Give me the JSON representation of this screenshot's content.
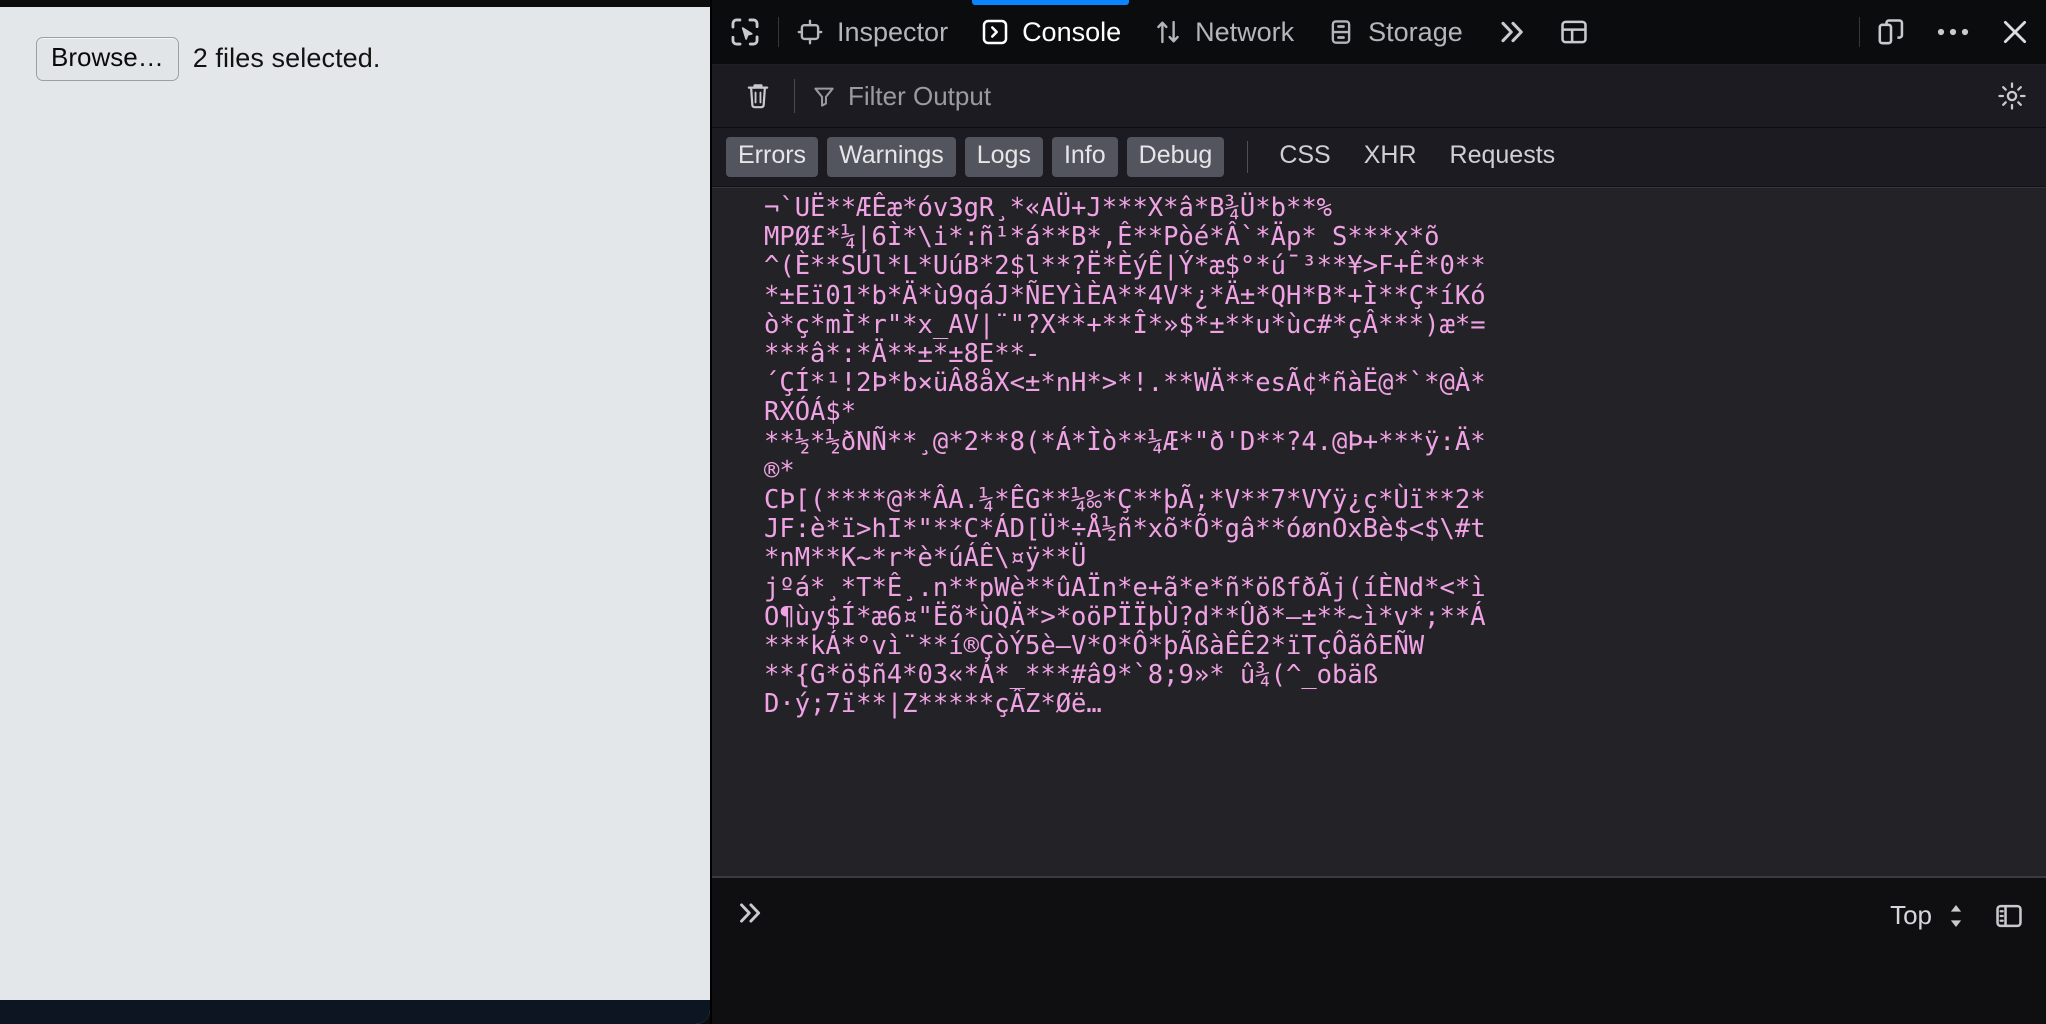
{
  "page": {
    "file_input": {
      "browse_label": "Browse…",
      "status_text": "2 files selected."
    }
  },
  "devtools": {
    "toolbar": {
      "picker_icon": "element-picker-icon",
      "tabs": [
        {
          "label": "Inspector",
          "icon": "inspector-icon",
          "active": false
        },
        {
          "label": "Console",
          "icon": "console-prompt-icon",
          "active": true
        },
        {
          "label": "Network",
          "icon": "network-arrows-icon",
          "active": false
        },
        {
          "label": "Storage",
          "icon": "storage-drawers-icon",
          "active": false
        }
      ],
      "overflow_icon": "chevron-double-right-icon",
      "layout_icon": "panel-layout-icon",
      "responsive_icon": "responsive-design-mode-icon",
      "meatball_icon": "ellipsis-icon",
      "close_icon": "close-icon"
    },
    "filterbar": {
      "clear_icon": "trash-icon",
      "filter_icon": "funnel-icon",
      "filter_placeholder": "Filter Output",
      "filter_value": "",
      "settings_icon": "gear-icon"
    },
    "filters": {
      "toggles": [
        {
          "label": "Errors",
          "on": true
        },
        {
          "label": "Warnings",
          "on": true
        },
        {
          "label": "Logs",
          "on": true
        },
        {
          "label": "Info",
          "on": true
        },
        {
          "label": "Debug",
          "on": true
        },
        {
          "label": "CSS",
          "on": false
        },
        {
          "label": "XHR",
          "on": false
        },
        {
          "label": "Requests",
          "on": false
        }
      ]
    },
    "console_output": {
      "message": "¬`UË**ÆÊæ*óv3gR¸*«AÜ+J***X*â*B¾Ü*b**%\nMPØ£*¼|6Ì*\\i*:ñ¹*á**B*,Ê**Pòé*Â`*Äp* S***x*õ\n^(È**SÚl*L*UúB*2$l**?Ë*ÈýÊ|Ý*æ$°*ú¯³**¥>F+Ê*0**\n*±Eï01*b*Ä*ù9qáJ*ÑEYìÈA**4V*¿*Ä±*QH*B*+Ì**Ç*íKó\nò*ç*mÌ*r\"*x_AV|¨\"?X**+**Î*»$*±**u*ùc#*çÂ***)æ*=\n***â*:*Ä**±*±8E**-\n´ÇÍ*¹!2Þ*b×üÂ8åX<±*nH*>*!.**WÄ**esÃ¢*ñàË@*`*@À*\nRXÓÁ$*\n**½*½ðNÑ**¸@*2**8(*Á*Ìò**¼Æ*\"ð'D**?4.@Þ+***ÿ:Ä*\n®*\nCÞ[(****@**ÂA.¼*ÊG**¼‰*Ç**þÃ;*V**7*VYÿ¿ç*Ùï**2*\nJF:è*ï>hI*\"**C*ÁD[Ü*÷Å½ñ*xõ*Õ*gâ**óønOxBè$<$\\#t\n*nM**K~*r*è*úÁÊ\\¤ÿ**Ü\njºá*¸*T*Ê¸.n**pWè**ûAÏn*e+ã*e*ñ*ößfðÃj(íÈNd*<*ì\nO¶ùy$Í*æ6¤\"Ëõ*ùQÄ*>*oöPÏÏþÙ?d**Ûð*–±**~ì*v*;**Á\n***kÁ*°vì¨**í®ÇòÝ5è–V*O*Ô*þÃßàÊÊ2*ïTçÔãôEÑW\n**{G*ö$ñ4*03«*Á*_***#â9*`8;9»* û¾(^_obäß\nD·ý;7ï**|Z*****çÂZ*Øë…"
    },
    "prompt": {
      "chevron_icon": "chevron-double-right-icon",
      "value": "",
      "context_label": "Top",
      "context_icon": "updown-chevrons-icon",
      "sidebar_icon": "console-sidebar-toggle-icon"
    }
  },
  "colors": {
    "accent_blue": "#0a84ff",
    "console_text_pink": "#f0a3e4",
    "output_bg": "#232327",
    "toolbar_bg": "#0b0c0e",
    "filterbar_bg": "#1c1b22",
    "page_bg": "#e4e7e9"
  }
}
